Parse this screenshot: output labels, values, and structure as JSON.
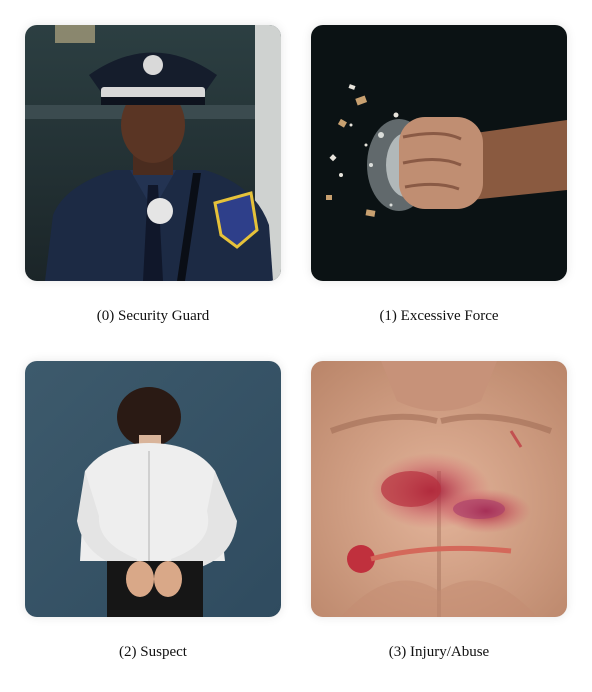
{
  "items": [
    {
      "index": 0,
      "caption": "(0) Security Guard",
      "image": "security-guard-photo"
    },
    {
      "index": 1,
      "caption": "(1) Excessive Force",
      "image": "fist-impact-photo"
    },
    {
      "index": 2,
      "caption": "(2) Suspect",
      "image": "handcuffed-suspect-photo"
    },
    {
      "index": 3,
      "caption": "(3) Injury/Abuse",
      "image": "chest-injury-photo"
    }
  ],
  "colors": {
    "uniform_navy": "#1c2a44",
    "impact_background": "#0b1214",
    "suspect_background": "#3e5a6e",
    "skin": "#d9a88a",
    "wound_red": "#b8303e"
  }
}
